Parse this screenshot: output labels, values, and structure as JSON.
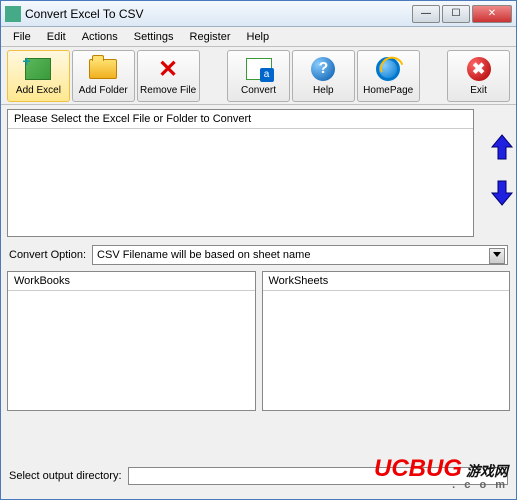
{
  "window": {
    "title": "Convert Excel To CSV"
  },
  "menu": {
    "file": "File",
    "edit": "Edit",
    "actions": "Actions",
    "settings": "Settings",
    "register": "Register",
    "help": "Help"
  },
  "toolbar": {
    "add_excel": "Add Excel",
    "add_folder": "Add Folder",
    "remove_file": "Remove File",
    "convert": "Convert",
    "help": "Help",
    "homepage": "HomePage",
    "exit": "Exit"
  },
  "filelist": {
    "header": "Please Select the Excel File or Folder to Convert"
  },
  "convert_option": {
    "label": "Convert Option:",
    "selected": "CSV Filename will be based on sheet name"
  },
  "panels": {
    "workbooks": "WorkBooks",
    "worksheets": "WorkSheets"
  },
  "output": {
    "label": "Select  output directory:",
    "value": ""
  },
  "watermark": {
    "brand": "UCBUG",
    "suffix": "游戏网",
    "dotcom": ". c o m"
  }
}
